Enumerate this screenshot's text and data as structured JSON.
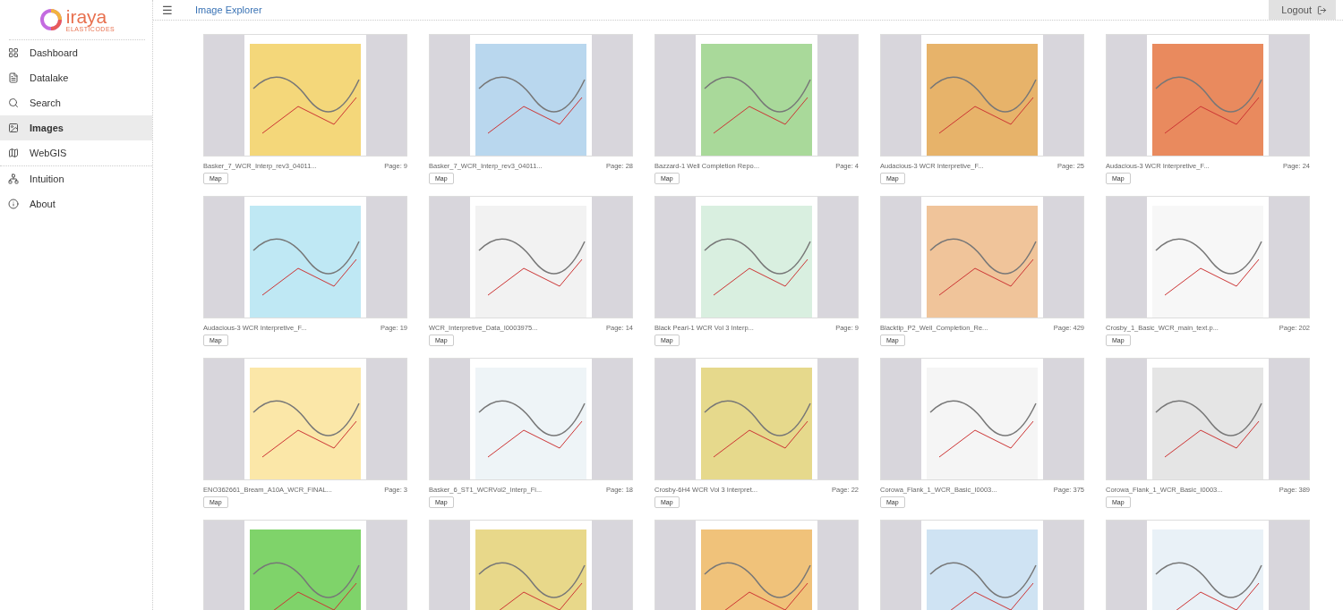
{
  "logo": {
    "name": "iraya",
    "tagline": "ELASTICODES"
  },
  "sidebar": {
    "items": [
      {
        "label": "Dashboard",
        "selected": false
      },
      {
        "label": "Datalake",
        "selected": false
      },
      {
        "label": "Search",
        "selected": false
      },
      {
        "label": "Images",
        "selected": true
      },
      {
        "label": "WebGIS",
        "selected": false
      },
      {
        "label": "Intuition",
        "selected": false
      },
      {
        "label": "About",
        "selected": false
      }
    ]
  },
  "header": {
    "menu_icon": "☰",
    "title": "Image Explorer",
    "logout": "Logout"
  },
  "gallery": [
    {
      "kind": "full",
      "caption": "Basker_7_WCR_Interp_rev3_04011...",
      "page": "Page: 9",
      "button": "Map",
      "color": "#f4d77a"
    },
    {
      "kind": "full",
      "caption": "Basker_7_WCR_Interp_rev3_04011...",
      "page": "Page: 28",
      "button": "Map",
      "color": "#b9d7ee"
    },
    {
      "kind": "full",
      "caption": "Bazzard-1 Well Completion Repo...",
      "page": "Page: 4",
      "button": "Map",
      "color": "#a9d99a"
    },
    {
      "kind": "full",
      "caption": "Audacious-3 WCR Interpretive_F...",
      "page": "Page: 25",
      "button": "Map",
      "color": "#e7b36a"
    },
    {
      "kind": "full",
      "caption": "Audacious-3 WCR Interpretive_F...",
      "page": "Page: 24",
      "button": "Map",
      "color": "#e98a5e"
    },
    {
      "kind": "full",
      "caption": "Audacious-3 WCR Interpretive_F...",
      "page": "Page: 19",
      "button": "Map",
      "color": "#bfe8f4"
    },
    {
      "kind": "full",
      "caption": "WCR_Interpretive_Data_I0003975...",
      "page": "Page: 14",
      "button": "Map",
      "color": "#f2f2f2"
    },
    {
      "kind": "full",
      "caption": "Black Pearl-1 WCR Vol 3 Interp...",
      "page": "Page: 9",
      "button": "Map",
      "color": "#d9efe0"
    },
    {
      "kind": "full",
      "caption": "Blacktip_P2_Well_Completion_Re...",
      "page": "Page: 429",
      "button": "Map",
      "color": "#f0c49a"
    },
    {
      "kind": "full",
      "caption": "Crosby_1_Basic_WCR_main_text.p...",
      "page": "Page: 202",
      "button": "Map",
      "color": "#f7f7f7"
    },
    {
      "kind": "full",
      "caption": "ENO362661_Bream_A10A_WCR_FINAL...",
      "page": "Page: 3",
      "button": "Map",
      "color": "#fbe7a8"
    },
    {
      "kind": "full",
      "caption": "Basker_6_ST1_WCRVol2_Interp_Fi...",
      "page": "Page: 18",
      "button": "Map",
      "color": "#eef4f7"
    },
    {
      "kind": "full",
      "caption": "Crosby-6H4 WCR Vol 3 Interpret...",
      "page": "Page: 22",
      "button": "Map",
      "color": "#e6d98c"
    },
    {
      "kind": "full",
      "caption": "Corowa_Flank_1_WCR_Basic_I0003...",
      "page": "Page: 375",
      "button": "Map",
      "color": "#f5f5f5"
    },
    {
      "kind": "full",
      "caption": "Corowa_Flank_1_WCR_Basic_I0003...",
      "page": "Page: 389",
      "button": "Map",
      "color": "#e5e5e5"
    },
    {
      "kind": "image-only",
      "color": "#7fd36a"
    },
    {
      "kind": "image-only",
      "color": "#e8d88a"
    },
    {
      "kind": "image-only",
      "color": "#f0c27a"
    },
    {
      "kind": "image-only",
      "color": "#cfe3f3"
    },
    {
      "kind": "image-only",
      "color": "#e9f1f7"
    }
  ]
}
